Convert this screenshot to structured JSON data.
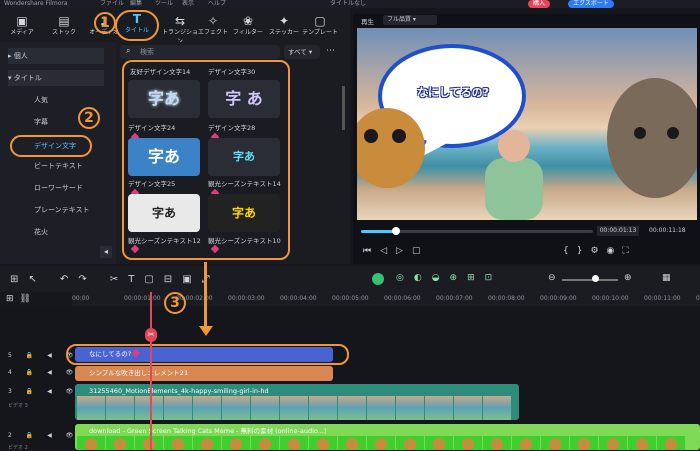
{
  "app": {
    "title": "Wondershare Filmora",
    "menu": [
      "ファイル",
      "編集",
      "ツール",
      "表示",
      "ヘルプ"
    ],
    "project": "タイトルなし",
    "buy": "購入",
    "export": "エクスポート"
  },
  "toolbar": {
    "items": [
      {
        "label": "メディア"
      },
      {
        "label": "ストック"
      },
      {
        "label": "オーディオ"
      },
      {
        "label": "タイトル"
      },
      {
        "label": "トランジション"
      },
      {
        "label": "エフェクト"
      },
      {
        "label": "フィルター"
      },
      {
        "label": "ステッカー"
      },
      {
        "label": "テンプレート"
      }
    ]
  },
  "sidebar": {
    "items": [
      {
        "label": "個人"
      },
      {
        "label": "タイトル"
      },
      {
        "label": "人気"
      },
      {
        "label": "字幕"
      },
      {
        "label": "デザイン文字"
      },
      {
        "label": "ビートテキスト"
      },
      {
        "label": "ローワーサード"
      },
      {
        "label": "プレーンテキスト"
      },
      {
        "label": "花火"
      }
    ]
  },
  "search": {
    "placeholder": "検索",
    "filter": "すべて"
  },
  "gallery": {
    "header_left": "友好デザイン文字14",
    "header_right": "デザイン文字30",
    "cards": [
      {
        "text": "字あ",
        "caption": "デザイン文字24"
      },
      {
        "text": "字 あ",
        "caption": "デザイン文字28"
      },
      {
        "text": "字あ",
        "caption": "デザイン文字25"
      },
      {
        "text": "字あ",
        "caption": "観光シーズンテキスト14"
      },
      {
        "text": "字あ",
        "caption": "観光シーズンテキスト12"
      },
      {
        "text": "字あ",
        "caption": "観光シーズンテキスト10"
      }
    ]
  },
  "preview": {
    "tab_player": "再生",
    "quality": "フル品質",
    "bubble": "なにしてるの?",
    "current_time": "00:00:01:13",
    "total_time": "00:00:11:18"
  },
  "annotations": {
    "n1": "1",
    "n2": "2",
    "n3": "3"
  },
  "ruler": {
    "ticks": [
      "00:00",
      "00:00:01:00",
      "00:00:02:00",
      "00:00:03:00",
      "00:00:04:00",
      "00:00:05:00",
      "00:00:06:00",
      "00:00:07:00",
      "00:00:08:00",
      "00:00:09:00",
      "00:00:10:00",
      "00:00:11:00",
      "00:00:12:00"
    ]
  },
  "tracks": [
    {
      "num": "5",
      "clip": "なにしてるの?"
    },
    {
      "num": "4",
      "clip": "シンプルな吹き出しエレメント21"
    },
    {
      "num": "3",
      "label": "ビデオ 3",
      "clip": "31255460_MotionElements_4k-happy-smiling-girl-in-hd"
    },
    {
      "num": "2",
      "label": "ビデオ 2",
      "clip": "download - Green Screen Talking Cats Meme - 無料の素材 (online-audio...)"
    }
  ],
  "colors": {
    "accent": "#f09838",
    "title_clip": "#4a63d2",
    "element_clip": "#d98753",
    "video_clip": "#2e8c7d",
    "green_clip": "#7ed957",
    "playhead": "#e2475a"
  }
}
